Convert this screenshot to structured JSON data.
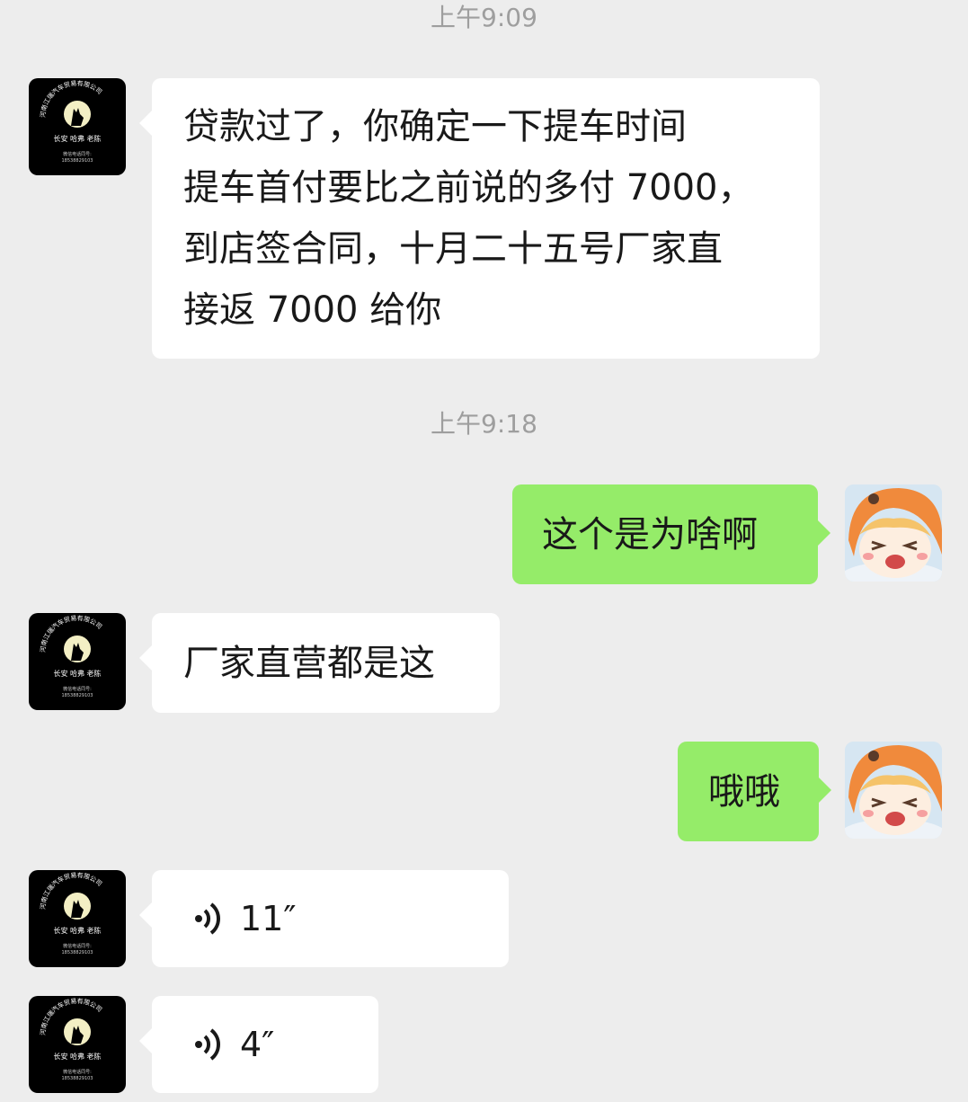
{
  "chat": {
    "time_1": "上午9:09",
    "time_2": "上午9:18",
    "msg_1": "贷款过了，你确定一下提车时间\n提车首付要比之前说的多付 7000，\n到店签合同，十月二十五号厂家直\n接返 7000 给你",
    "msg_2": "这个是为啥啊",
    "msg_3": "厂家直营都是这",
    "msg_4": "哦哦",
    "voice_1": "11″",
    "voice_2": "4″"
  },
  "seller_avatar": {
    "arc_text": "河南江瑞汽车贸易有限公司",
    "name_line": "长安 哈弗 老陈",
    "contact_label": "微信电话同号:",
    "contact_number": "18538829103"
  },
  "icons": {
    "voice": "voice-wave-icon",
    "seller": "wolf-moon-logo",
    "me": "anime-girl-avatar"
  },
  "colors": {
    "background": "#ededed",
    "incoming_bubble": "#ffffff",
    "outgoing_bubble": "#95ec69",
    "timestamp": "#9e9e9e"
  }
}
